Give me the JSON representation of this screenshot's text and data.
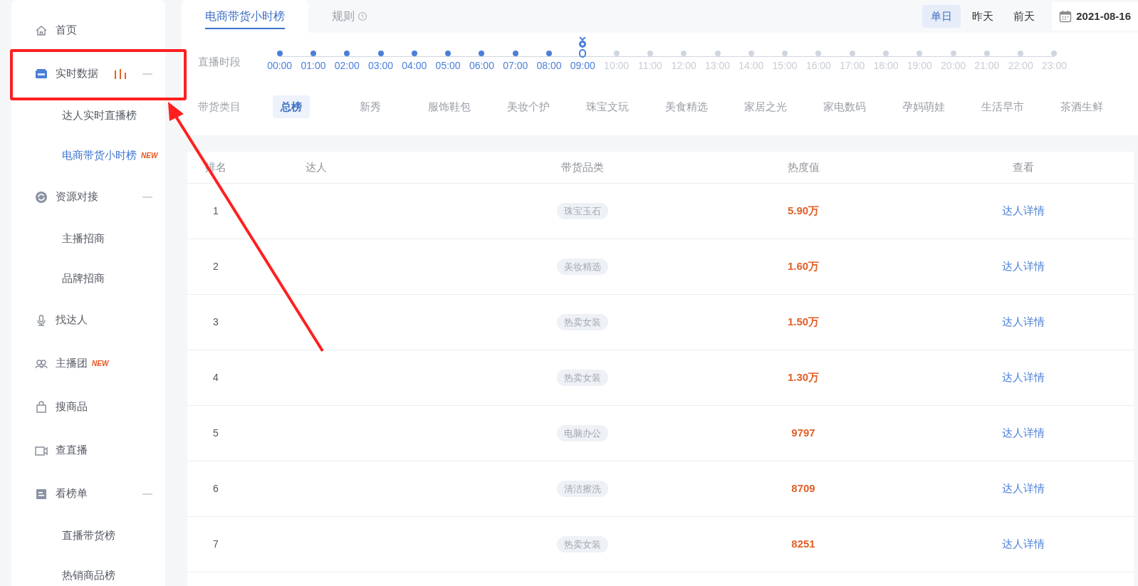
{
  "sidebar": {
    "items": [
      {
        "kind": "item",
        "label": "首页",
        "selected": false
      },
      {
        "kind": "group",
        "label": "实时数据",
        "live": true,
        "expanded": true,
        "children": [
          {
            "label": "达人实时直播榜",
            "selected": false
          },
          {
            "label": "电商带货小时榜",
            "selected": true,
            "badge": "NEW"
          }
        ]
      },
      {
        "kind": "group",
        "label": "资源对接",
        "live": false,
        "expanded": true,
        "children": [
          {
            "label": "主播招商",
            "selected": false
          },
          {
            "label": "品牌招商",
            "selected": false
          }
        ]
      },
      {
        "kind": "item",
        "label": "找达人",
        "selected": false
      },
      {
        "kind": "item",
        "label": "主播团",
        "selected": false,
        "badge": "NEW"
      },
      {
        "kind": "item",
        "label": "搜商品",
        "selected": false
      },
      {
        "kind": "item",
        "label": "查直播",
        "selected": false
      },
      {
        "kind": "group",
        "label": "看榜单",
        "live": false,
        "expanded": true,
        "children": [
          {
            "label": "直播带货榜",
            "selected": false
          },
          {
            "label": "热销商品榜",
            "selected": false
          }
        ]
      }
    ]
  },
  "tabs": [
    {
      "label": "电商带货小时榜",
      "selected": true,
      "info": false
    },
    {
      "label": "规则",
      "selected": false,
      "info": true
    }
  ],
  "day_switch": [
    {
      "label": "单日",
      "selected": true
    },
    {
      "label": "昨天",
      "selected": false
    },
    {
      "label": "前天",
      "selected": false
    }
  ],
  "date": "2021-08-16",
  "timeline": {
    "label": "直播时段",
    "hours": [
      {
        "label": "00:00",
        "available": true,
        "selected": false
      },
      {
        "label": "01:00",
        "available": true,
        "selected": false
      },
      {
        "label": "02:00",
        "available": true,
        "selected": false
      },
      {
        "label": "03:00",
        "available": true,
        "selected": false
      },
      {
        "label": "04:00",
        "available": true,
        "selected": false
      },
      {
        "label": "05:00",
        "available": true,
        "selected": false
      },
      {
        "label": "06:00",
        "available": true,
        "selected": false
      },
      {
        "label": "07:00",
        "available": true,
        "selected": false
      },
      {
        "label": "08:00",
        "available": true,
        "selected": false
      },
      {
        "label": "09:00",
        "available": true,
        "selected": true
      },
      {
        "label": "10:00",
        "available": false,
        "selected": false
      },
      {
        "label": "11:00",
        "available": false,
        "selected": false
      },
      {
        "label": "12:00",
        "available": false,
        "selected": false
      },
      {
        "label": "13:00",
        "available": false,
        "selected": false
      },
      {
        "label": "14:00",
        "available": false,
        "selected": false
      },
      {
        "label": "15:00",
        "available": false,
        "selected": false
      },
      {
        "label": "16:00",
        "available": false,
        "selected": false
      },
      {
        "label": "17:00",
        "available": false,
        "selected": false
      },
      {
        "label": "18:00",
        "available": false,
        "selected": false
      },
      {
        "label": "19:00",
        "available": false,
        "selected": false
      },
      {
        "label": "20:00",
        "available": false,
        "selected": false
      },
      {
        "label": "21:00",
        "available": false,
        "selected": false
      },
      {
        "label": "22:00",
        "available": false,
        "selected": false
      },
      {
        "label": "23:00",
        "available": false,
        "selected": false
      }
    ]
  },
  "categories": {
    "label": "带货类目",
    "items": [
      {
        "label": "总榜",
        "selected": true
      },
      {
        "label": "新秀",
        "selected": false
      },
      {
        "label": "服饰鞋包",
        "selected": false
      },
      {
        "label": "美妆个护",
        "selected": false
      },
      {
        "label": "珠宝文玩",
        "selected": false
      },
      {
        "label": "美食精选",
        "selected": false
      },
      {
        "label": "家居之光",
        "selected": false
      },
      {
        "label": "家电数码",
        "selected": false
      },
      {
        "label": "孕妈萌娃",
        "selected": false
      },
      {
        "label": "生活早市",
        "selected": false
      },
      {
        "label": "茶酒生鲜",
        "selected": false
      }
    ]
  },
  "table": {
    "columns": [
      "排名",
      "达人",
      "带货品类",
      "热度值",
      "查看"
    ],
    "rows": [
      {
        "rank": "1",
        "category": "珠宝玉石",
        "heat": "5.90万",
        "action": "达人详情"
      },
      {
        "rank": "2",
        "category": "美妆精选",
        "heat": "1.60万",
        "action": "达人详情"
      },
      {
        "rank": "3",
        "category": "热卖女装",
        "heat": "1.50万",
        "action": "达人详情"
      },
      {
        "rank": "4",
        "category": "热卖女装",
        "heat": "1.30万",
        "action": "达人详情"
      },
      {
        "rank": "5",
        "category": "电脑办公",
        "heat": "9797",
        "action": "达人详情"
      },
      {
        "rank": "6",
        "category": "清洁擦洗",
        "heat": "8709",
        "action": "达人详情"
      },
      {
        "rank": "7",
        "category": "热卖女装",
        "heat": "8251",
        "action": "达人详情"
      }
    ]
  }
}
